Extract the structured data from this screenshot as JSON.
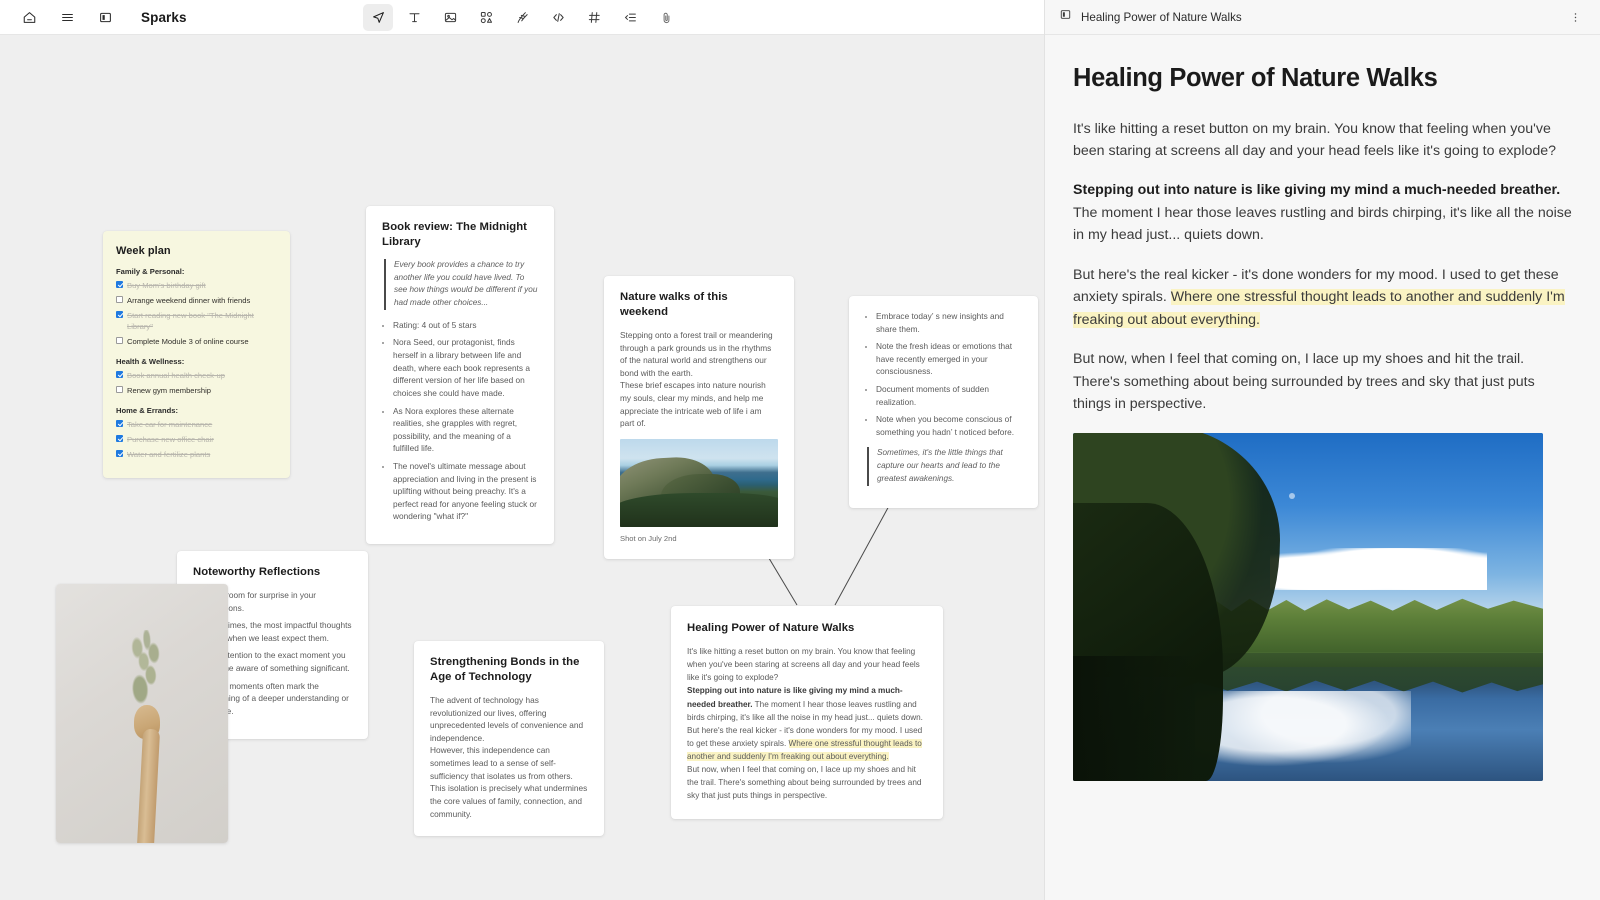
{
  "app": {
    "title": "Sparks",
    "toolbar_left": [
      {
        "name": "home-icon",
        "label": "Home"
      },
      {
        "name": "menu-icon",
        "label": "Menu"
      },
      {
        "name": "panel-toggle-icon",
        "label": "Toggle panel"
      }
    ],
    "tools": [
      {
        "name": "select-pointer-tool",
        "label": "Select",
        "active": true
      },
      {
        "name": "text-tool",
        "label": "Text",
        "active": false
      },
      {
        "name": "image-tool",
        "label": "Image",
        "active": false
      },
      {
        "name": "widgets-tool",
        "label": "Widgets",
        "active": false
      },
      {
        "name": "draw-tool",
        "label": "Draw",
        "active": false
      },
      {
        "name": "code-tool",
        "label": "Code",
        "active": false
      },
      {
        "name": "frame-tool",
        "label": "Frame",
        "active": false
      },
      {
        "name": "list-tool",
        "label": "List",
        "active": false
      },
      {
        "name": "attachment-tool",
        "label": "Attach",
        "active": false
      }
    ]
  },
  "cards": {
    "week_plan": {
      "title": "Week plan",
      "groups": [
        {
          "name": "Family & Personal:",
          "items": [
            {
              "text": "Buy Mom's birthday gift",
              "done": true
            },
            {
              "text": "Arrange weekend dinner with friends",
              "done": false
            },
            {
              "text": "Start reading new book \"The Midnight Library\"",
              "done": true
            },
            {
              "text": "Complete Module 3 of online course",
              "done": false
            }
          ]
        },
        {
          "name": "Health & Wellness:",
          "items": [
            {
              "text": "Book annual health check-up",
              "done": true
            },
            {
              "text": "Renew gym membership",
              "done": false
            }
          ]
        },
        {
          "name": "Home & Errands:",
          "items": [
            {
              "text": "Take car for maintenance",
              "done": true
            },
            {
              "text": "Purchase new office chair",
              "done": true
            },
            {
              "text": "Water and fertilize plants",
              "done": true
            }
          ]
        }
      ]
    },
    "book_review": {
      "title": "Book review: The Midnight Library",
      "quote": "Every book provides a chance to try another life you could have lived. To see how things would be different if you had made other choices...",
      "bullets": [
        "Rating: 4 out of 5 stars",
        "Nora Seed, our protagonist, finds herself in a library between life and death, where each book represents a different version of her life based on choices she could have made.",
        "As Nora explores these alternate realities, she grapples with regret, possibility, and the meaning of a fulfilled life.",
        "The novel's ultimate message about appreciation and living in the present is uplifting without being preachy. It's a perfect read for anyone feeling stuck or wondering \"what if?\""
      ]
    },
    "nature_walks": {
      "title": "Nature walks of this weekend",
      "paragraph1": "Stepping onto a forest trail or meandering through a park grounds us in the rhythms of the natural world and strengthens our bond with the earth.",
      "paragraph2": "These brief escapes into nature nourish my souls, clear my minds, and help me appreciate the intricate web of life i am part of.",
      "photo_caption": "Shot on July 2nd",
      "photo_alt": "coastal-hillside-photo"
    },
    "insights": {
      "bullets": [
        "Embrace today’ s new insights and share them.",
        "Note the fresh ideas or emotions that have recently emerged in your consciousness.",
        "Document moments of sudden realization.",
        "Note when you become conscious of something you hadn’ t noticed before."
      ],
      "quote": "Sometimes, it's the little things that capture our hearts and lead to the greatest awakenings."
    },
    "noteworthy": {
      "title": "Noteworthy Reflections",
      "bullets": [
        "Allow room for surprise in your reflections.",
        "Sometimes, the most impactful thoughts come when we least expect them.",
        "Pay attention to the exact moment you become aware of something significant.",
        "These moments often mark the beginning of a deeper understanding or change."
      ]
    },
    "photo_card": {
      "alt": "hand-holding-dried-plant-photo"
    },
    "bonds": {
      "title": "Strengthening Bonds in the Age of Technology",
      "paragraph1": "The advent of technology has revolutionized our lives, offering unprecedented levels of convenience and independence.",
      "paragraph2": "However, this independence can sometimes lead to a sense of self-sufficiency that isolates us from others. This isolation is precisely what undermines the core values of family, connection, and community."
    },
    "healing": {
      "title": "Healing Power of Nature Walks",
      "p1": "It's like hitting a reset button on my brain. You know that feeling when you've been staring at screens all day and your head feels like it's going to explode?",
      "p2_bold": "Stepping out into nature is like giving my mind a much-needed breather.",
      "p2_rest": " The moment I hear those leaves rustling and birds chirping, it's like all the noise in my head just... quiets down.",
      "p3_pre": "But here's the real kicker - it's done wonders for my mood. I used to get these anxiety spirals. ",
      "p3_highlight": "Where one stressful thought leads to another and suddenly I'm freaking out about everything.",
      "p4": "But now, when I feel that coming on, I lace up my shoes and hit the trail. There's something about being surrounded by trees and sky that just puts things in perspective."
    }
  },
  "right_panel": {
    "header_title": "Healing Power of Nature Walks",
    "header_icon": "note-icon",
    "menu_icon": "more-vertical-icon",
    "doc_title": "Healing Power of Nature Walks",
    "p1": "It's like hitting a reset button on my brain. You know that feeling when you've been staring at screens all day and your head feels like it's going to explode?",
    "p2_bold": "Stepping out into nature is like giving my mind a much-needed breather.",
    "p2_rest": " The moment I hear those leaves rustling and birds chirping, it's like all the noise in my head just... quiets down.",
    "p3_pre": "But here's the real kicker - it's done wonders for my mood. I used to get these anxiety spirals. ",
    "p3_highlight": "Where one stressful thought leads to another and suddenly I'm freaking out about everything.",
    "p4": "But now, when I feel that coming on, I lace up my shoes and hit the trail. There's something about being surrounded by trees and sky that just puts things in perspective.",
    "image_alt": "forest-lake-reflection-photo"
  },
  "colors": {
    "canvas_bg": "#efefef",
    "panel_bg": "#f7f7f7",
    "note_yellow": "#f7f7e0",
    "highlight_yellow": "#faf3c3",
    "checkbox_blue": "#1f7ae0"
  }
}
